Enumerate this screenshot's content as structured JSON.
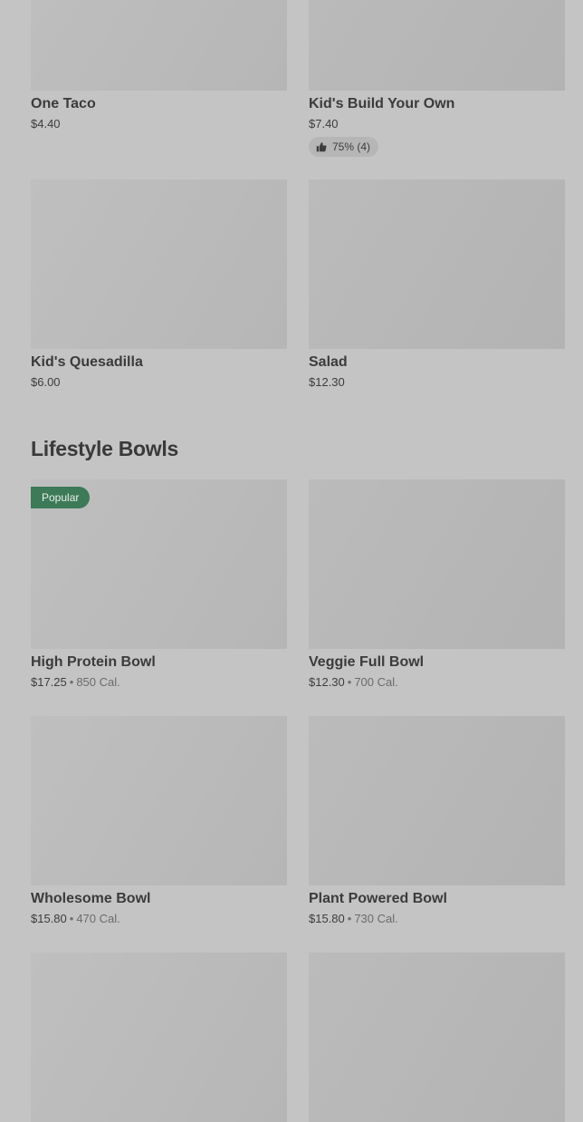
{
  "top_items": [
    {
      "name": "One Taco",
      "price": "$4.40"
    },
    {
      "name": "Kid's Build Your Own",
      "price": "$7.40",
      "rating": "75% (4)"
    },
    {
      "name": "Kid's Quesadilla",
      "price": "$6.00"
    },
    {
      "name": "Salad",
      "price": "$12.30"
    }
  ],
  "lifestyle_bowls": {
    "title": "Lifestyle Bowls",
    "items": [
      {
        "name": "High Protein Bowl",
        "price": "$17.25",
        "calories": "850 Cal.",
        "badge": "Popular"
      },
      {
        "name": "Veggie Full Bowl",
        "price": "$12.30",
        "calories": "700 Cal."
      },
      {
        "name": "Wholesome Bowl",
        "price": "$15.80",
        "calories": "470 Cal."
      },
      {
        "name": "Plant Powered Bowl",
        "price": "$15.80",
        "calories": "730 Cal."
      }
    ]
  },
  "separator": "•",
  "colors": {
    "background": "#c4c4c4",
    "badge": "#3c7a58",
    "text": "#3a3a3a"
  },
  "icons": {
    "rating": "thumbs-up-icon"
  }
}
